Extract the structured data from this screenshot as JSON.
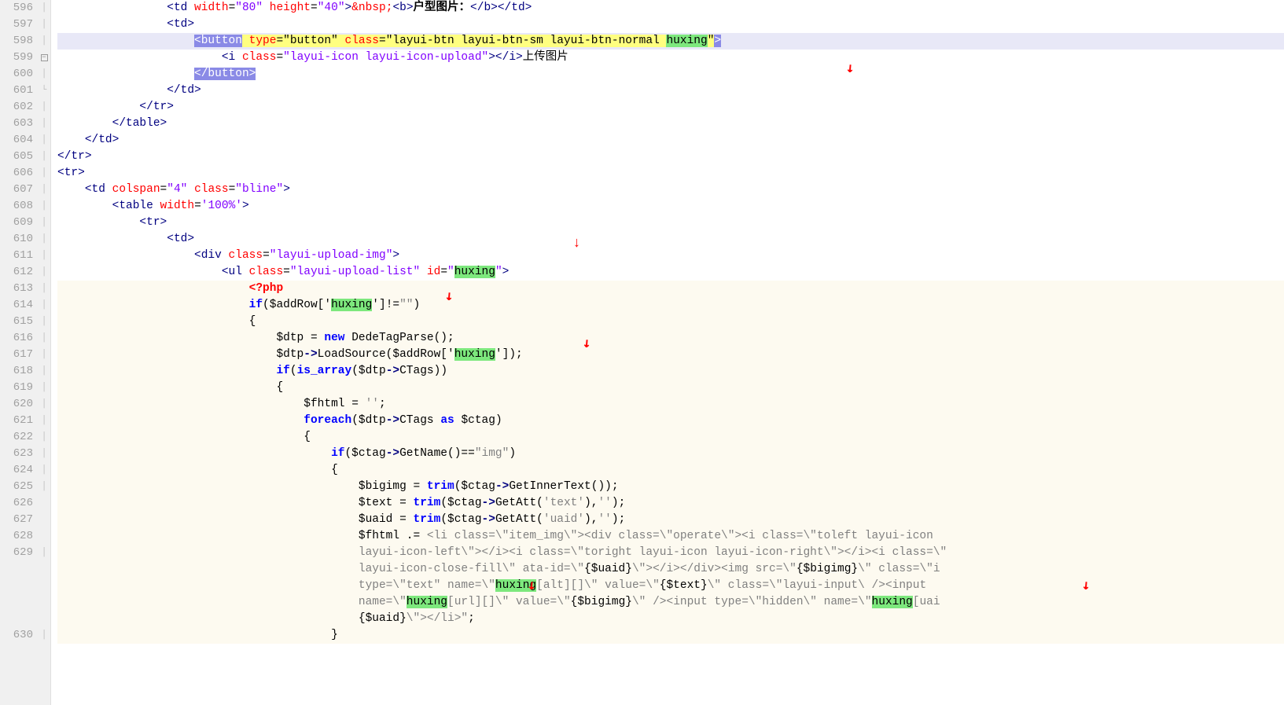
{
  "highlighted_token": "huxing",
  "lines": [
    {
      "num": "596",
      "fold": "dash"
    },
    {
      "num": "597",
      "fold": "dash"
    },
    {
      "num": "598",
      "fold": "dash"
    },
    {
      "num": "599",
      "fold": "box-minus"
    },
    {
      "num": "600",
      "fold": "bar"
    },
    {
      "num": "601",
      "fold": "end"
    },
    {
      "num": "602",
      "fold": "dash"
    },
    {
      "num": "603",
      "fold": "dash"
    },
    {
      "num": "604",
      "fold": "dash"
    },
    {
      "num": "605",
      "fold": "dash"
    },
    {
      "num": "606",
      "fold": "dash"
    },
    {
      "num": "607",
      "fold": "dash"
    },
    {
      "num": "608",
      "fold": "dash"
    },
    {
      "num": "609",
      "fold": "dash"
    },
    {
      "num": "610",
      "fold": "dash"
    },
    {
      "num": "611",
      "fold": "dash"
    },
    {
      "num": "612",
      "fold": "dash"
    },
    {
      "num": "613",
      "fold": "dash"
    },
    {
      "num": "614",
      "fold": "dash"
    },
    {
      "num": "615",
      "fold": "dash"
    },
    {
      "num": "616",
      "fold": "dash"
    },
    {
      "num": "617",
      "fold": "dash"
    },
    {
      "num": "618",
      "fold": "dash"
    },
    {
      "num": "619",
      "fold": "dash"
    },
    {
      "num": "620",
      "fold": "dash"
    },
    {
      "num": "621",
      "fold": "dash"
    },
    {
      "num": "622",
      "fold": "dash"
    },
    {
      "num": "623",
      "fold": "dash"
    },
    {
      "num": "624",
      "fold": "dash"
    },
    {
      "num": "625",
      "fold": "dash"
    },
    {
      "num": "626",
      "fold": "none"
    },
    {
      "num": "627",
      "fold": "none"
    },
    {
      "num": "628",
      "fold": "none"
    },
    {
      "num": "629",
      "fold": "dash"
    },
    {
      "num": "",
      "fold": "none"
    },
    {
      "num": "",
      "fold": "none"
    },
    {
      "num": "",
      "fold": "none"
    },
    {
      "num": "",
      "fold": "none"
    },
    {
      "num": "630",
      "fold": "dash"
    }
  ],
  "code": {
    "l597_width": "80",
    "l597_height": "40",
    "l597_entity": "&nbsp;",
    "l597_label": "户型图片：",
    "l599_type": "button",
    "l599_class": "layui-btn layui-btn-sm layui-btn-normal huxing",
    "l600_class": "layui-icon layui-icon-upload",
    "l600_text": "上传图片",
    "l608_colspan": "4",
    "l608_class": "bline",
    "l609_width": "100%",
    "l612_class": "layui-upload-img",
    "l613_class": "layui-upload-list",
    "l613_id": "huxing",
    "l615_arrvar": "$addRow",
    "l615_key": "huxing",
    "l617_var": "$dtp",
    "l617_class": "DedeTagParse",
    "l618_key": "huxing",
    "l619_func": "is_array",
    "l619_prop": "CTags",
    "l621_var": "$fhtml",
    "l622_var": "$ctag",
    "l624_method": "GetName",
    "l624_val": "img",
    "l626_var": "$bigimg",
    "l626_method": "GetInnerText",
    "l627_var": "$text",
    "l627_method": "GetAtt",
    "l627_arg": "text",
    "l628_var": "$uaid",
    "l628_method": "GetAtt",
    "l628_arg": "uaid",
    "l629a": "<li class=\\\"item_img\\\"><div class=\\\"operate\\\"><i class=\\\"toleft layui-icon ",
    "l629b": "layui-icon-left\\\"></i><i class=\\\"toright layui-icon layui-icon-right\\\"></i><i class=\\\"",
    "l629c_pre": "layui-icon-close-fill\\\" ",
    "l629c_mid": "ata-id=\\\"",
    "l629c_post": "\\\"></i></div><img src=\\\"",
    "l629c_end": "\\\" class=\\\"i",
    "l629d_pre": "type=\\\"text",
    "l629d_mid": "\" name=\\\"",
    "l629d_post": "[alt][]\\\" value=\\\"",
    "l629d_end": "\\\" class=\\\"layui-input\\",
    "l629d_end2": "/><input ",
    "l629e_pre": "name=\\\"",
    "l629e_mid": "[url][]\\\" value=\\\"",
    "l629e_post": "\\\" /><input type=\\\"hidden\\\" name=\\\"",
    "l629e_end": "[uai",
    "l629f": "\\\"></li>\"",
    "interp_uaid": "{$uaid}",
    "interp_bigimg": "{$bigimg}",
    "interp_text": "{$text}"
  }
}
